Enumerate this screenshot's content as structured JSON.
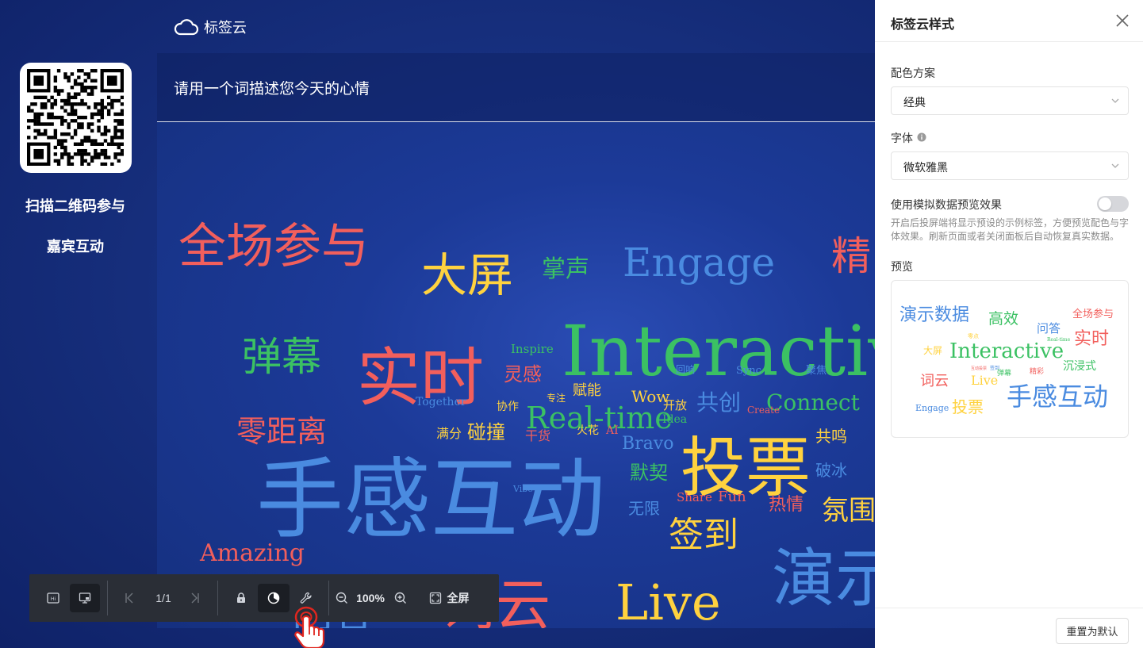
{
  "app": {
    "title": "标签云"
  },
  "qr": {
    "caption_line1": "扫描二维码参与",
    "caption_line2": "嘉宾互动"
  },
  "question": {
    "text": "请用一个词描述您今天的心情"
  },
  "colors": {
    "red": "#f25f5c",
    "yellow": "#ffd23f",
    "green": "#3bc163",
    "blue": "#4a8be0",
    "stage_bg": "#17307f",
    "toolbar_bg": "#2a2e36"
  },
  "word_cloud": {
    "words": [
      {
        "text": "全场参与",
        "color": "red",
        "size": 60
      },
      {
        "text": "大屏",
        "color": "yellow",
        "size": 58
      },
      {
        "text": "掌声",
        "color": "green",
        "size": 30
      },
      {
        "text": "Engage",
        "color": "blue",
        "size": 50
      },
      {
        "text": "精",
        "color": "red",
        "size": 50
      },
      {
        "text": "弹幕",
        "color": "green",
        "size": 50
      },
      {
        "text": "实时",
        "color": "red",
        "size": 80
      },
      {
        "text": "Inspire",
        "color": "green",
        "size": 15
      },
      {
        "text": "灵感",
        "color": "red",
        "size": 24
      },
      {
        "text": "Interactive",
        "color": "green",
        "size": 88
      },
      {
        "text": "零距离",
        "color": "red",
        "size": 38
      },
      {
        "text": "Together",
        "color": "blue",
        "size": 14
      },
      {
        "text": "协作",
        "color": "yellow",
        "size": 14
      },
      {
        "text": "专注",
        "color": "yellow",
        "size": 12
      },
      {
        "text": "赋能",
        "color": "yellow",
        "size": 18
      },
      {
        "text": "Wow",
        "color": "yellow",
        "size": 20
      },
      {
        "text": "回响",
        "color": "blue",
        "size": 12
      },
      {
        "text": "Sync",
        "color": "blue",
        "size": 13
      },
      {
        "text": "聚焦",
        "color": "blue",
        "size": 13
      },
      {
        "text": "开放",
        "color": "yellow",
        "size": 15
      },
      {
        "text": "共创",
        "color": "blue",
        "size": 28
      },
      {
        "text": "Connect",
        "color": "green",
        "size": 28
      },
      {
        "text": "碰撞",
        "color": "yellow",
        "size": 24
      },
      {
        "text": "Real-time",
        "color": "green",
        "size": 38
      },
      {
        "text": "Create",
        "color": "red",
        "size": 12
      },
      {
        "text": "满分",
        "color": "yellow",
        "size": 16
      },
      {
        "text": "干货",
        "color": "red",
        "size": 16
      },
      {
        "text": "火花",
        "color": "yellow",
        "size": 14
      },
      {
        "text": "AI",
        "color": "red",
        "size": 14
      },
      {
        "text": "Idea",
        "color": "green",
        "size": 14
      },
      {
        "text": "投票",
        "color": "yellow",
        "size": 82
      },
      {
        "text": "共鸣",
        "color": "yellow",
        "size": 20
      },
      {
        "text": "Bravo",
        "color": "blue",
        "size": 22
      },
      {
        "text": "破冰",
        "color": "blue",
        "size": 20
      },
      {
        "text": "手感互动",
        "color": "blue",
        "size": 110
      },
      {
        "text": "默契",
        "color": "green",
        "size": 24
      },
      {
        "text": "Vibe",
        "color": "blue",
        "size": 11
      },
      {
        "text": "Share",
        "color": "red",
        "size": 15
      },
      {
        "text": "Fun",
        "color": "red",
        "size": 18
      },
      {
        "text": "热情",
        "color": "red",
        "size": 22
      },
      {
        "text": "氛围",
        "color": "yellow",
        "size": 34
      },
      {
        "text": "无限",
        "color": "blue",
        "size": 20
      },
      {
        "text": "签到",
        "color": "yellow",
        "size": 44
      },
      {
        "text": "Amazing",
        "color": "red",
        "size": 30
      },
      {
        "text": "演示",
        "color": "blue",
        "size": 80
      },
      {
        "text": "问答",
        "color": "blue",
        "size": 52
      },
      {
        "text": "词云",
        "color": "red",
        "size": 70
      },
      {
        "text": "Live",
        "color": "yellow",
        "size": 62
      }
    ]
  },
  "toolbar": {
    "page_indicator": "1/1",
    "zoom_value": "100%",
    "fullscreen_label": "全屏",
    "icons": [
      "hi-icon",
      "screen-icon",
      "first-page-icon",
      "last-page-icon",
      "lock-icon",
      "pie-chart-icon",
      "wrench-icon",
      "zoom-out-icon",
      "zoom-in-icon",
      "fullscreen-icon"
    ]
  },
  "side_panel": {
    "title": "标签云样式",
    "color_scheme_label": "配色方案",
    "color_scheme_value": "经典",
    "font_label": "字体",
    "font_value": "微软雅黑",
    "mock_label": "使用模拟数据预览效果",
    "mock_enabled": false,
    "mock_description": "开启后投屏端将显示预设的示例标签，方便预览配色与字体效果。刷新页面或者关闭面板后自动恢复真实数据。",
    "preview_label": "预览",
    "reset_label": "重置为默认"
  },
  "preview_cloud": {
    "words": [
      {
        "text": "演示数据",
        "color": "blue",
        "size": 22
      },
      {
        "text": "高效",
        "color": "green",
        "size": 19
      },
      {
        "text": "问答",
        "color": "blue",
        "size": 15
      },
      {
        "text": "全场参与",
        "color": "red",
        "size": 13
      },
      {
        "text": "零点",
        "color": "yellow",
        "size": 7
      },
      {
        "text": "Real-time",
        "color": "green",
        "size": 6
      },
      {
        "text": "实时",
        "color": "red",
        "size": 22
      },
      {
        "text": "大屏",
        "color": "yellow",
        "size": 12
      },
      {
        "text": "Interactive",
        "color": "green",
        "size": 26
      },
      {
        "text": "沉浸式",
        "color": "green",
        "size": 14
      },
      {
        "text": "词云",
        "color": "red",
        "size": 18
      },
      {
        "text": "互动投票",
        "color": "red",
        "size": 5
      },
      {
        "text": "签到",
        "color": "blue",
        "size": 6
      },
      {
        "text": "弹幕",
        "color": "green",
        "size": 9
      },
      {
        "text": "精彩",
        "color": "red",
        "size": 9
      },
      {
        "text": "Live",
        "color": "yellow",
        "size": 16
      },
      {
        "text": "Engage",
        "color": "blue",
        "size": 11
      },
      {
        "text": "投票",
        "color": "yellow",
        "size": 20
      },
      {
        "text": "手感互动",
        "color": "blue",
        "size": 32
      }
    ]
  }
}
